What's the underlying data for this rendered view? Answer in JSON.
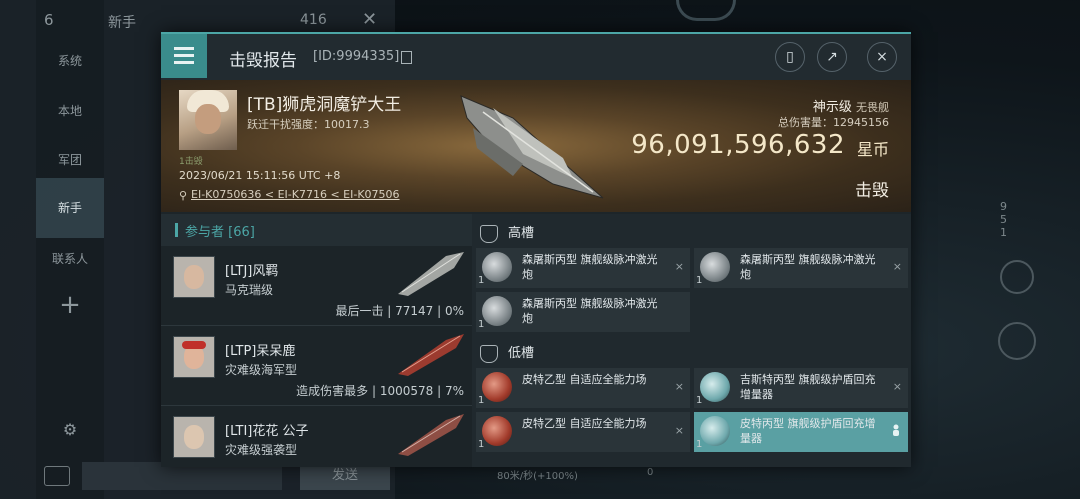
{
  "background": {
    "chat_count": "6",
    "chat_channel": "新手",
    "chat_number": "416",
    "sidebar": [
      "系统",
      "本地",
      "军团",
      "新手",
      "联系人"
    ],
    "send_label": "发送",
    "speed": "80米/秒(+100%)",
    "zero": "0",
    "hud_counts": [
      "9",
      "5",
      "1"
    ]
  },
  "dialog": {
    "title": "击毁报告",
    "id_label": "[ID:9994335]",
    "victim": {
      "name": "[TB]狮虎洞魔铲大王",
      "warp_strength": "跃迁干扰强度：10017.3",
      "small_tag": "1击毁",
      "time": "2023/06/21 15:11:56 UTC +8",
      "location": "EI-K0750636 < EI-K7716 < EI-K07506",
      "ship_class": "神示级",
      "ship_type": "无畏舰",
      "total_damage": "总伤害量：12945156",
      "isk_value": "96,091,596,632",
      "isk_unit": "星币",
      "status": "击毁"
    },
    "participants": {
      "label": "参与者 [66]",
      "items": [
        {
          "name": "[LTJ]风羁",
          "ship": "马克瑞级",
          "stats": "最后一击 | 77147 | 0%"
        },
        {
          "name": "[LTP]呆呆鹿",
          "ship": "灾难级海军型",
          "stats": "造成伤害最多 | 1000578 | 7%"
        },
        {
          "name": "[LTI]花花 公子",
          "ship": "灾难级强袭型",
          "stats": ""
        }
      ]
    },
    "high_slot": {
      "label": "高槽",
      "modules": [
        {
          "name": "森屠斯丙型 旗舰级脉冲激光炮",
          "qty": "1"
        },
        {
          "name": "森屠斯丙型 旗舰级脉冲激光炮",
          "qty": "1"
        },
        {
          "name": "森屠斯丙型 旗舰级脉冲激光炮",
          "qty": "1"
        }
      ]
    },
    "low_slot": {
      "label": "低槽",
      "modules": [
        {
          "name": "皮特乙型 自适应全能力场",
          "qty": "1"
        },
        {
          "name": "吉斯特丙型 旗舰级护盾回充增量器",
          "qty": "1"
        },
        {
          "name": "皮特乙型 自适应全能力场",
          "qty": "1"
        },
        {
          "name": "皮特丙型 旗舰级护盾回充增量器",
          "qty": "1"
        }
      ]
    },
    "close_mark": "×"
  }
}
